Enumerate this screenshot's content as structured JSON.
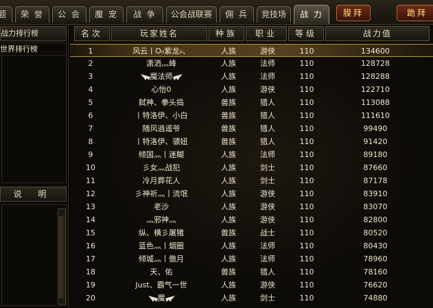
{
  "tabs": [
    "题",
    "荣 誉",
    "公 会",
    "魔 宠",
    "战 争",
    "公会战联赛",
    "佣 兵",
    "竞技场",
    "战 力"
  ],
  "active_tab_index": 8,
  "actions": {
    "worship": "膜拜",
    "kneel": "跪拜"
  },
  "left": {
    "ranking_header": "战力排行榜",
    "items": [
      "世界排行榜"
    ],
    "description_header": "说 明"
  },
  "table": {
    "headers": {
      "rank": "名次",
      "name": "玩家姓名",
      "race": "种族",
      "job": "职业",
      "level": "等级",
      "power": "战力值"
    },
    "rows": [
      {
        "rank": "1",
        "name": "风云丨O₀紫龙₀、",
        "race": "人族",
        "job": "游侠",
        "level": "110",
        "power": "134600",
        "selected": true,
        "wings": false
      },
      {
        "rank": "2",
        "name": "潇洒灬峰",
        "race": "人族",
        "job": "法师",
        "level": "110",
        "power": "128728",
        "wings": false
      },
      {
        "rank": "3",
        "name": "魔法师",
        "race": "人族",
        "job": "法师",
        "level": "110",
        "power": "128288",
        "wings": true
      },
      {
        "rank": "4",
        "name": "心怡0",
        "race": "人族",
        "job": "游侠",
        "level": "110",
        "power": "122710",
        "wings": false
      },
      {
        "rank": "5",
        "name": "弑神、拳头捣",
        "race": "兽族",
        "job": "猎人",
        "level": "110",
        "power": "113088",
        "wings": false
      },
      {
        "rank": "6",
        "name": "丨特洛伊、小白",
        "race": "兽族",
        "job": "猎人",
        "level": "110",
        "power": "111610",
        "wings": false
      },
      {
        "rank": "7",
        "name": "随风逍遥爷",
        "race": "兽族",
        "job": "猎人",
        "level": "110",
        "power": "99490",
        "wings": false
      },
      {
        "rank": "8",
        "name": "丨特洛伊、骠妞",
        "race": "兽族",
        "job": "猎人",
        "level": "110",
        "power": "91420",
        "wings": false
      },
      {
        "rank": "9",
        "name": "倾国灬丨迷糊",
        "race": "人族",
        "job": "法师",
        "level": "110",
        "power": "89180",
        "wings": false
      },
      {
        "rank": "10",
        "name": "彡女灬战犯",
        "race": "人族",
        "job": "剑士",
        "level": "110",
        "power": "87660",
        "wings": false
      },
      {
        "rank": "11",
        "name": "冷月葬花人",
        "race": "人族",
        "job": "剑士",
        "level": "110",
        "power": "87178",
        "wings": false
      },
      {
        "rank": "12",
        "name": "彡神祈灬丨流氓",
        "race": "人族",
        "job": "游侠",
        "level": "110",
        "power": "83910",
        "wings": false
      },
      {
        "rank": "13",
        "name": "老沙",
        "race": "人族",
        "job": "游侠",
        "level": "110",
        "power": "83070",
        "wings": false
      },
      {
        "rank": "14",
        "name": "灬邪神灬",
        "race": "人族",
        "job": "游侠",
        "level": "110",
        "power": "82800",
        "wings": false
      },
      {
        "rank": "15",
        "name": "纵、横彡屠猪",
        "race": "兽族",
        "job": "战士",
        "level": "110",
        "power": "80520",
        "wings": false
      },
      {
        "rank": "16",
        "name": "蓝色灬丨烟圈",
        "race": "人族",
        "job": "法师",
        "level": "110",
        "power": "80430",
        "wings": false
      },
      {
        "rank": "17",
        "name": "倾城灬丨傲月",
        "race": "人族",
        "job": "法师",
        "level": "110",
        "power": "78960",
        "wings": false
      },
      {
        "rank": "18",
        "name": "天、佑",
        "race": "兽族",
        "job": "猎人",
        "level": "110",
        "power": "78160",
        "wings": false
      },
      {
        "rank": "19",
        "name": "Just、霸气一世",
        "race": "人族",
        "job": "游侠",
        "level": "110",
        "power": "76620",
        "wings": false
      },
      {
        "rank": "20",
        "name": "魔",
        "race": "人族",
        "job": "剑士",
        "level": "110",
        "power": "74880",
        "wings": true
      }
    ]
  }
}
